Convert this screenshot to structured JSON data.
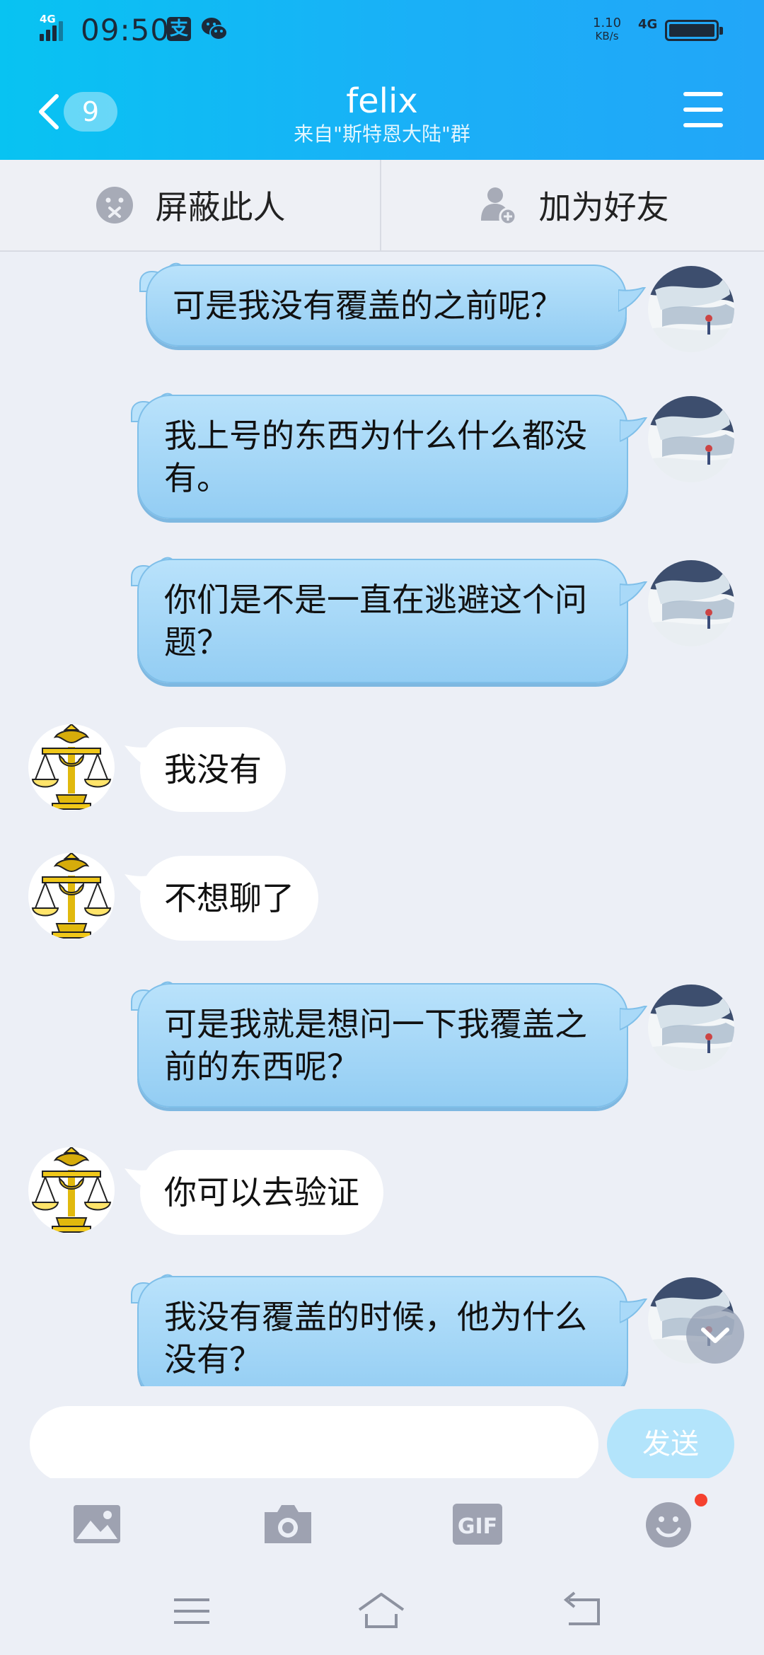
{
  "status_bar": {
    "network_tag": "4G",
    "time": "09:50",
    "app_icon_1": "支",
    "speed_value": "1.10",
    "speed_unit": "KB/s",
    "network_type": "4G"
  },
  "header": {
    "unread_count": "9",
    "title": "felix",
    "subtitle": "来自\"斯特恩大陆\"群"
  },
  "actions": {
    "block_label": "屏蔽此人",
    "add_friend_label": "加为好友"
  },
  "messages": [
    {
      "side": "me",
      "text": "可是我没有覆盖的之前呢？"
    },
    {
      "side": "me",
      "text": "我上号的东西为什么什么都没有。"
    },
    {
      "side": "me",
      "text": "你们是不是一直在逃避这个问题？"
    },
    {
      "side": "them",
      "text": "我没有"
    },
    {
      "side": "them",
      "text": "不想聊了"
    },
    {
      "side": "me",
      "text": "可是我就是想问一下我覆盖之前的东西呢？"
    },
    {
      "side": "them",
      "text": "你可以去验证"
    },
    {
      "side": "me",
      "text": "我没有覆盖的时候，他为什么没有？"
    }
  ],
  "input": {
    "value": "",
    "send_label": "发送"
  },
  "icons": {
    "back": "chevron-left-icon",
    "menu": "hamburger-menu-icon",
    "block": "block-user-icon",
    "add_friend": "add-friend-icon",
    "image": "image-icon",
    "camera": "camera-icon",
    "gif": "gif-icon",
    "emoji": "emoji-icon",
    "scroll_down": "chevron-down-icon"
  },
  "colors": {
    "header_start": "#08c3f2",
    "header_end": "#22a6f8",
    "my_bubble": "#a9d9f8",
    "their_bubble": "#ffffff",
    "background": "#eceff6",
    "send_button": "#b3e4fb",
    "badge": "#f5412f"
  },
  "toolbar": {
    "gif_label": "GIF"
  }
}
